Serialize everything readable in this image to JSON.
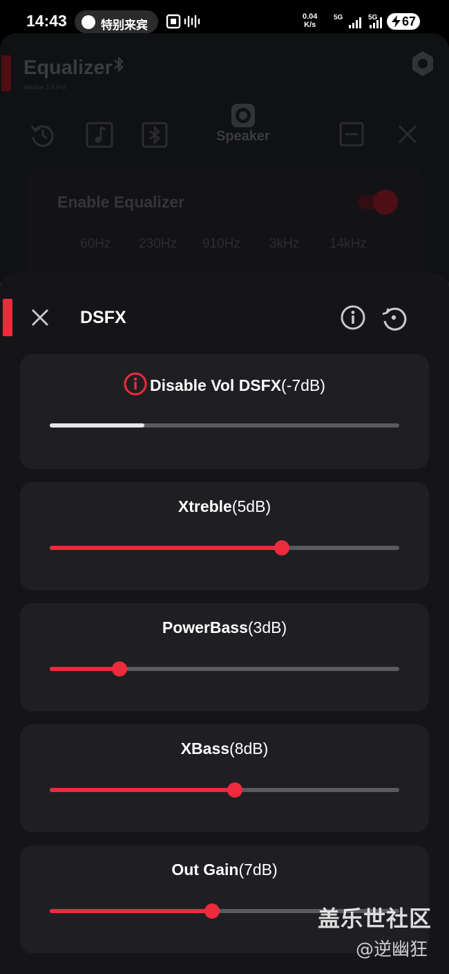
{
  "status_bar": {
    "time": "14:43",
    "pill_text": "特别来宾",
    "speed_value": "0.04",
    "speed_unit": "K/s",
    "net1": "5G",
    "net2": "5G",
    "battery": "67"
  },
  "app": {
    "title": "Equalizer",
    "version": "Version 1.9 Pro",
    "output_label": "Speaker",
    "enable_label": "Enable Equalizer",
    "enable_state": true,
    "frequencies": [
      "60Hz",
      "230Hz",
      "910Hz",
      "3kHz",
      "14kHz"
    ]
  },
  "sheet": {
    "title": "DSFX",
    "controls": [
      {
        "name": "Disable Vol DSFX",
        "value_text": "(-7dB)",
        "level": 0.27,
        "disabled": true
      },
      {
        "name": "Xtreble",
        "value_text": "(5dB)",
        "level": 0.665,
        "disabled": false
      },
      {
        "name": "PowerBass",
        "value_text": "(3dB)",
        "level": 0.2,
        "disabled": false
      },
      {
        "name": "XBass",
        "value_text": "(8dB)",
        "level": 0.53,
        "disabled": false
      },
      {
        "name": "Out Gain",
        "value_text": "(7dB)",
        "level": 0.465,
        "disabled": false
      }
    ]
  },
  "watermark": {
    "line1": "盖乐世社区",
    "line2": "@逆幽狂"
  },
  "colors": {
    "accent": "#ee2a3d",
    "sheet_bg": "#151518",
    "card_bg": "#1f1f23",
    "track": "#5b5b5f"
  }
}
